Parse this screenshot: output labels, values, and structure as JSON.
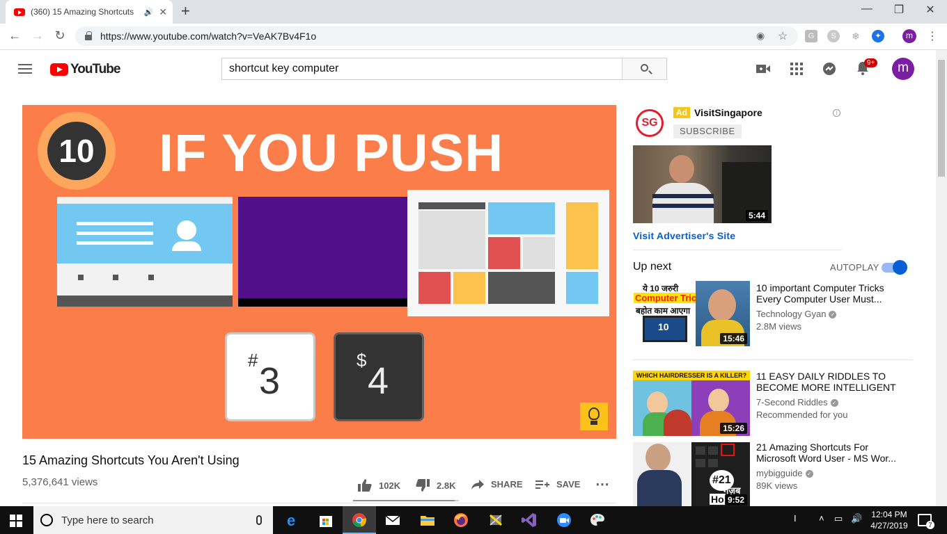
{
  "browser": {
    "tab_title": "(360) 15 Amazing Shortcuts",
    "url": "https://www.youtube.com/watch?v=VeAK7Bv4F1o",
    "profile_initial": "m"
  },
  "youtube": {
    "logo_text": "YouTube",
    "search_value": "shortcut key computer",
    "notification_badge": "9+",
    "avatar_initial": "m"
  },
  "video": {
    "thumb_number": "10",
    "thumb_headline": "IF YOU PUSH",
    "key3_symbol": "#",
    "key3_number": "3",
    "key4_symbol": "$",
    "key4_number": "4",
    "title": "15 Amazing Shortcuts You Aren't Using",
    "views": "5,376,641 views",
    "likes": "102K",
    "dislikes": "2.8K",
    "share_label": "SHARE",
    "save_label": "SAVE",
    "like_ratio": 0.96
  },
  "ad": {
    "logo_text": "SG",
    "badge": "Ad",
    "advertiser": "VisitSingapore",
    "subscribe_label": "SUBSCRIBE",
    "duration": "5:44",
    "link_label": "Visit Advertiser's Site"
  },
  "upnext": {
    "label": "Up next",
    "autoplay_label": "AUTOPLAY",
    "autoplay_on": true,
    "videos": [
      {
        "title": "10 important Computer Tricks Every Computer User Must...",
        "channel": "Technology Gyan",
        "verified": true,
        "meta": "2.8M views",
        "duration": "15:46",
        "thumb_line1": "ये 10 जरुरी",
        "thumb_line2": "Computer Tricks",
        "thumb_line3": "बहोत काम आएगा",
        "thumb_screen": "10"
      },
      {
        "title": "11 EASY DAILY RIDDLES TO BECOME MORE INTELLIGENT",
        "channel": "7-Second Riddles",
        "verified": true,
        "meta": "Recommended for you",
        "duration": "15:26",
        "thumb_banner": "WHICH HAIRDRESSER IS A KILLER?"
      },
      {
        "title": "21 Amazing Shortcuts For Microsoft Word User - MS Wor...",
        "channel": "mybigguide",
        "verified": true,
        "meta": "89K views",
        "duration": "9:52",
        "thumb_badge": "#21",
        "thumb_hindi": "गज़ब",
        "thumb_partial": "Ho"
      }
    ]
  },
  "taskbar": {
    "search_placeholder": "Type here to search",
    "time": "12:04 PM",
    "date": "4/27/2019",
    "notifications": "7"
  },
  "colors": {
    "youtube_red": "#ff0000",
    "thumb_orange": "#fb7d4a",
    "link_blue": "#065fd4",
    "avatar_purple": "#7b1fa2"
  }
}
